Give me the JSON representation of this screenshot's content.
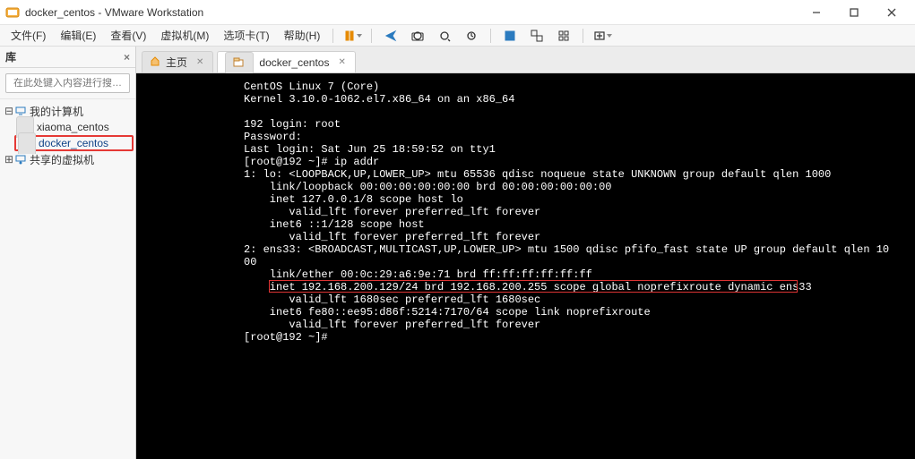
{
  "window": {
    "title": "docker_centos - VMware Workstation"
  },
  "menu": {
    "file": "文件(F)",
    "edit": "编辑(E)",
    "view": "查看(V)",
    "vm": "虚拟机(M)",
    "tabs": "选项卡(T)",
    "help": "帮助(H)"
  },
  "sidebar": {
    "heading": "库",
    "search_placeholder": "在此处键入内容进行搜…",
    "root": "我的计算机",
    "item_xiaoma": "xiaoma_centos",
    "item_docker": "docker_centos",
    "item_shared": "共享的虚拟机"
  },
  "tabs": {
    "home": "主页",
    "docker": "docker_centos"
  },
  "terminal": {
    "lines": [
      "CentOS Linux 7 (Core)",
      "Kernel 3.10.0-1062.el7.x86_64 on an x86_64",
      "",
      "192 login: root",
      "Password:",
      "Last login: Sat Jun 25 18:59:52 on tty1",
      "[root@192 ~]# ip addr",
      "1: lo: <LOOPBACK,UP,LOWER_UP> mtu 65536 qdisc noqueue state UNKNOWN group default qlen 1000",
      "    link/loopback 00:00:00:00:00:00 brd 00:00:00:00:00:00",
      "    inet 127.0.0.1/8 scope host lo",
      "       valid_lft forever preferred_lft forever",
      "    inet6 ::1/128 scope host",
      "       valid_lft forever preferred_lft forever",
      "2: ens33: <BROADCAST,MULTICAST,UP,LOWER_UP> mtu 1500 qdisc pfifo_fast state UP group default qlen 10",
      "00",
      "    link/ether 00:0c:29:a6:9e:71 brd ff:ff:ff:ff:ff:ff",
      "    inet 192.168.200.129/24 brd 192.168.200.255 scope global noprefixroute dynamic ens33",
      "       valid_lft 1680sec preferred_lft 1680sec",
      "    inet6 fe80::ee95:d86f:5214:7170/64 scope link noprefixroute",
      "       valid_lft forever preferred_lft forever",
      "[root@192 ~]#"
    ],
    "highlight_line_index": 16
  }
}
